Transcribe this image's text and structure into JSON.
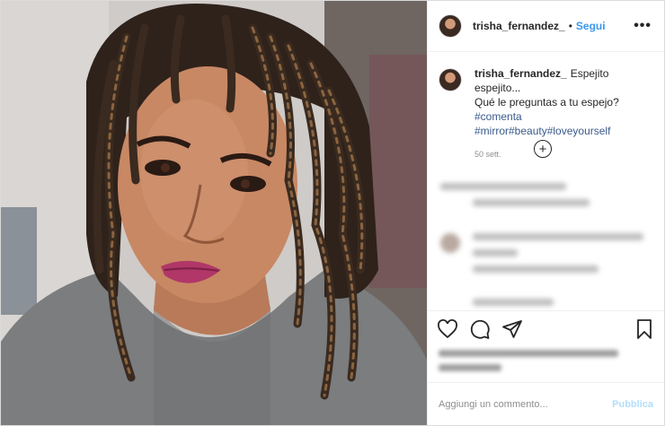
{
  "post": {
    "author": "trisha_fernandez_",
    "follow_label": "Segui",
    "dot": "•",
    "more_label": "•••"
  },
  "caption": {
    "author": "trisha_fernandez_",
    "text_line1": "Espejito espejito...",
    "text_line2": "Qué le preguntas a tu espejo?",
    "hashtags_line1": "#comenta",
    "hashtags_line2": [
      "#mirror",
      "#beauty",
      "#loveyourself"
    ],
    "age": "50 sett."
  },
  "load_more_symbol": "+",
  "comment_box": {
    "placeholder": "Aggiungi un commento...",
    "publish_label": "Pubblica"
  },
  "icons": [
    "heart-icon",
    "comment-icon",
    "share-icon",
    "bookmark-icon",
    "plus-circle-icon",
    "more-icon"
  ],
  "colors": {
    "link_blue": "#3897f0",
    "hashtag": "#3a5a8c",
    "publish_disabled": "#b2dffc",
    "muted": "#8e8e8e"
  }
}
